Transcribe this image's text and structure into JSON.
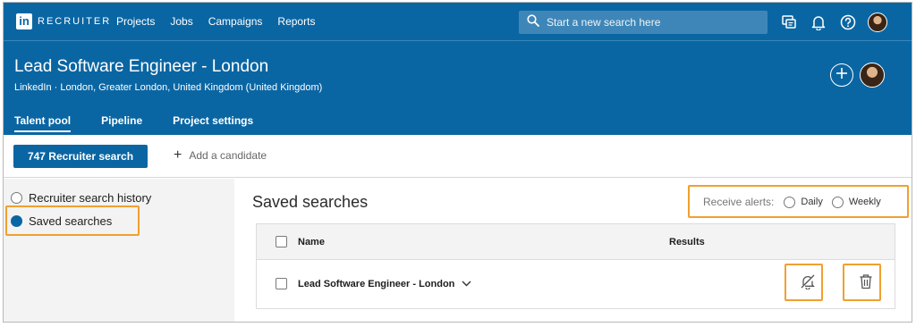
{
  "app": {
    "brand": "RECRUITER",
    "logo_letters": "in",
    "nav": [
      "Projects",
      "Jobs",
      "Campaigns",
      "Reports"
    ],
    "search": {
      "placeholder": "Start a new search here"
    },
    "icons": [
      "search-icon",
      "messages-icon",
      "bell-icon",
      "help-icon",
      "avatar"
    ]
  },
  "project": {
    "title": "Lead Software Engineer - London",
    "subtitle": "LinkedIn  ·  London, Greater London, United Kingdom (United Kingdom)",
    "tabs": [
      "Talent pool",
      "Pipeline",
      "Project settings"
    ],
    "active_tab": "Talent pool"
  },
  "actions": {
    "primary_button": "747 Recruiter search",
    "add_candidate": "Add a candidate"
  },
  "sidebar": {
    "items": [
      {
        "label": "Recruiter search history",
        "selected": false
      },
      {
        "label": "Saved searches",
        "selected": true
      }
    ]
  },
  "main": {
    "title": "Saved searches",
    "alerts": {
      "label": "Receive alerts:",
      "options": [
        "Daily",
        "Weekly"
      ]
    },
    "table": {
      "columns": [
        "Name",
        "Results"
      ],
      "rows": [
        {
          "name": "Lead Software Engineer - London",
          "results": ""
        }
      ]
    }
  },
  "colors": {
    "brand_blue": "#0a66a3",
    "highlight_orange": "#f0a030"
  }
}
